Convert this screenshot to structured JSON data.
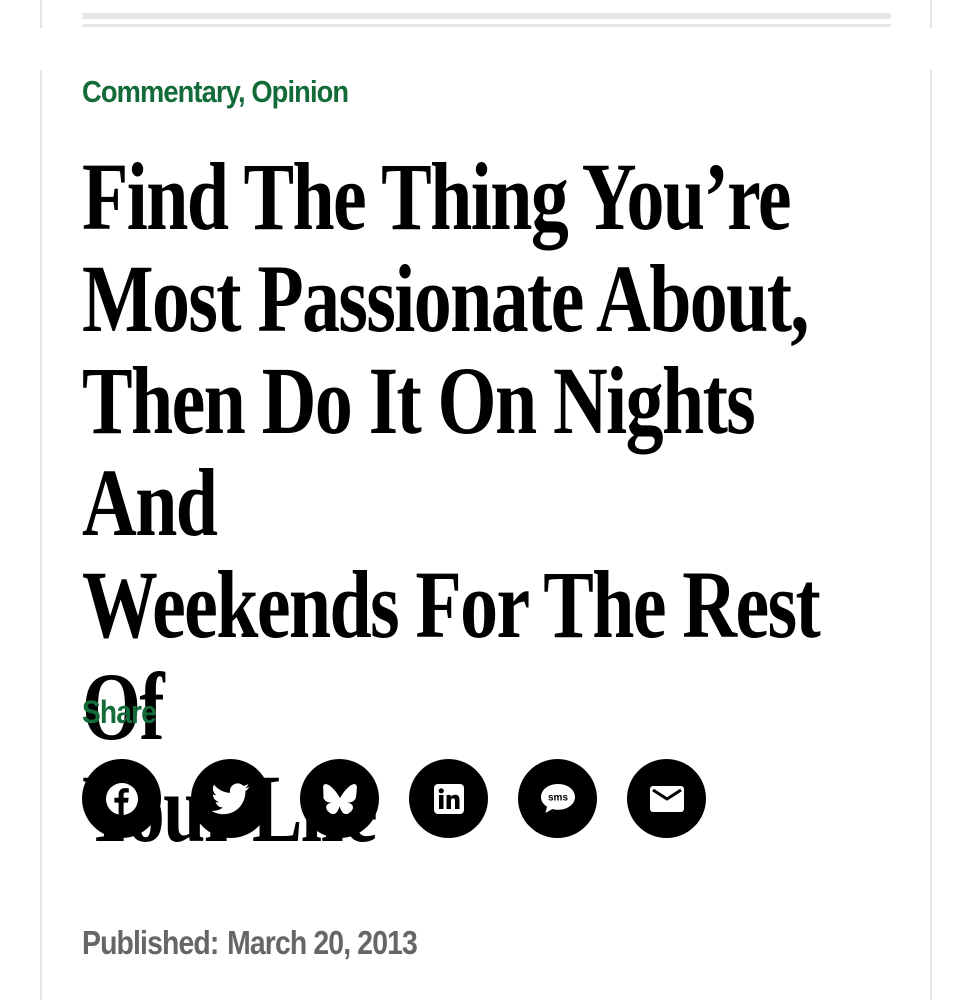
{
  "article": {
    "categories": [
      "Commentary",
      "Opinion"
    ],
    "category_separator": ", ",
    "title": "Find The Thing You’re Most Passionate About, Then Do It On Nights And Weekends For The Rest Of Your Life",
    "title_lines": [
      "Find The Thing You’re",
      "Most Passionate About,",
      "Then Do It On Nights And",
      "Weekends For The Rest Of",
      "Your Life"
    ],
    "published_label": "Published:",
    "published_date": "March 20, 2013"
  },
  "share": {
    "label": "Share",
    "buttons": [
      {
        "name": "facebook",
        "icon": "facebook-icon"
      },
      {
        "name": "twitter",
        "icon": "twitter-bird-icon"
      },
      {
        "name": "bluesky",
        "icon": "bluesky-butterfly-icon"
      },
      {
        "name": "linkedin",
        "icon": "linkedin-icon"
      },
      {
        "name": "sms",
        "icon": "sms-bubble-icon",
        "text": "sms"
      },
      {
        "name": "email",
        "icon": "envelope-icon"
      }
    ]
  },
  "colors": {
    "accent": "#146b3a",
    "headline": "#000000",
    "meta": "#666666",
    "rule": "#e4e4e4"
  }
}
